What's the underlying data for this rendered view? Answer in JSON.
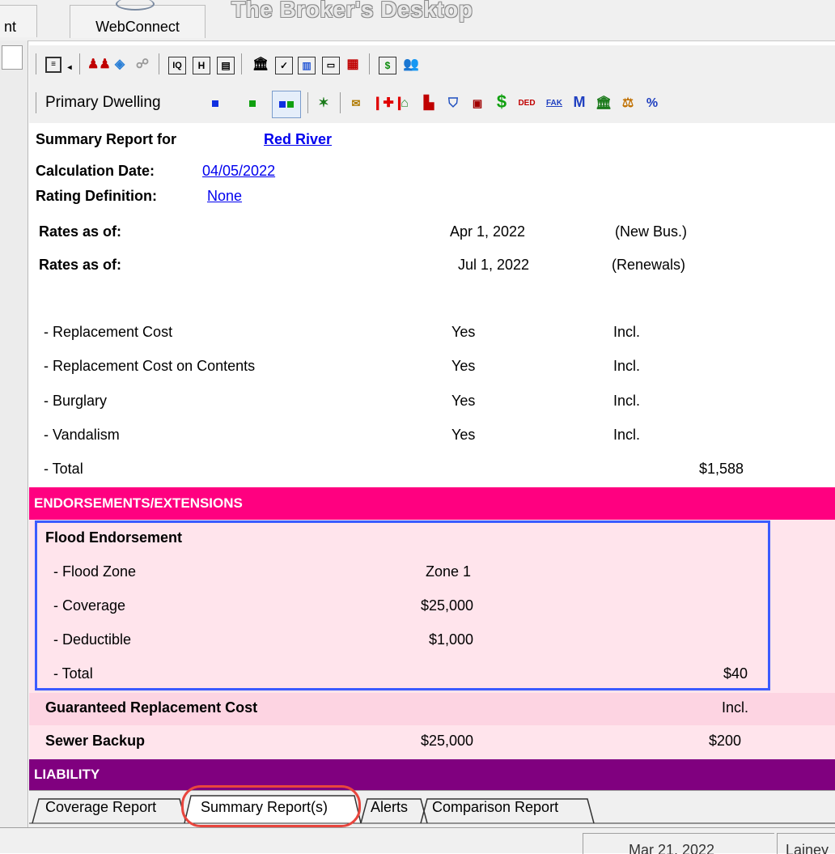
{
  "top": {
    "left_tab_partial": "nt",
    "webconnect_tab": "WebConnect",
    "app_title": "The Broker's Desktop"
  },
  "toolbar2": {
    "dwelling_label": "Primary Dwelling"
  },
  "report": {
    "summary_label": "Summary Report for",
    "summary_name": "Red River",
    "calc_label": "Calculation Date:",
    "calc_date": "04/05/2022",
    "rating_label": "Rating Definition:",
    "rating_value": "None",
    "rates": [
      {
        "label": "Rates as of:",
        "date": "Apr 1, 2022",
        "note": "(New Bus.)"
      },
      {
        "label": "Rates as of:",
        "date": "Jul 1, 2022",
        "note": "(Renewals)"
      }
    ],
    "coverages": [
      {
        "label": "- Replacement Cost",
        "value": "Yes",
        "status": "Incl."
      },
      {
        "label": "- Replacement Cost on Contents",
        "value": "Yes",
        "status": "Incl."
      },
      {
        "label": "- Burglary",
        "value": "Yes",
        "status": "Incl."
      },
      {
        "label": "- Vandalism",
        "value": "Yes",
        "status": "Incl."
      }
    ],
    "total_label": "- Total",
    "total_value": "$1,588",
    "endorsements_header": "ENDORSEMENTS/EXTENSIONS",
    "flood": {
      "title": "Flood Endorsement",
      "zone_label": "- Flood Zone",
      "zone_value": "Zone 1",
      "coverage_label": "- Coverage",
      "coverage_value": "$25,000",
      "deductible_label": "- Deductible",
      "deductible_value": "$1,000",
      "total_label": "- Total",
      "total_value": "$40"
    },
    "gcr_label": "Guaranteed Replacement Cost",
    "gcr_value": "Incl.",
    "sewer_label": "Sewer Backup",
    "sewer_amount": "$25,000",
    "sewer_premium": "$200",
    "liability_header": "LIABILITY"
  },
  "tabs": [
    {
      "label": "Coverage Report"
    },
    {
      "label": "Summary Report(s)"
    },
    {
      "label": "Alerts"
    },
    {
      "label": "Comparison Report"
    }
  ],
  "status": {
    "date_partial": "Mar 21, 2022",
    "user_partial": "Lainey"
  },
  "colors": {
    "endorsement_bar": "#ff0080",
    "liability_bar": "#80007f",
    "highlight_box": "#3b5bff",
    "tab_circle": "#e8463e"
  }
}
